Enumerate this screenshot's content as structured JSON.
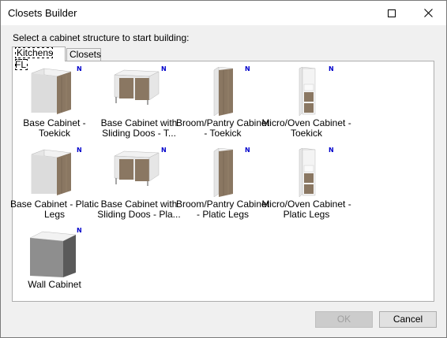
{
  "window": {
    "title": "Closets Builder"
  },
  "prompt": "Select a cabinet structure to start building:",
  "tabs": [
    {
      "label": "Kitchens FL"
    },
    {
      "label": "Closets"
    }
  ],
  "items": [
    {
      "label": "Base Cabinet - Toekick",
      "badge": "N",
      "kind": "base"
    },
    {
      "label": "Base Cabinet with Sliding Doos - T...",
      "badge": "N",
      "kind": "sliding"
    },
    {
      "label": "Broom/Pantry Cabinet - Toekick",
      "badge": "N",
      "kind": "pantry"
    },
    {
      "label": "Micro/Oven Cabinet - Toekick",
      "badge": "N",
      "kind": "oven"
    },
    {
      "label": "Base Cabinet - Platic Legs",
      "badge": "N",
      "kind": "base"
    },
    {
      "label": "Base Cabinet with Sliding Doos - Pla...",
      "badge": "N",
      "kind": "sliding"
    },
    {
      "label": "Broom/Pantry Cabinet - Platic Legs",
      "badge": "N",
      "kind": "pantry"
    },
    {
      "label": "Micro/Oven Cabinet - Platic Legs",
      "badge": "N",
      "kind": "oven"
    },
    {
      "label": "Wall Cabinet",
      "badge": "N",
      "kind": "wall"
    }
  ],
  "buttons": {
    "ok": "OK",
    "cancel": "Cancel"
  },
  "colors": {
    "wood": "#8a7762",
    "carcass": "#e6e6e6",
    "badge": "#0000cc"
  }
}
